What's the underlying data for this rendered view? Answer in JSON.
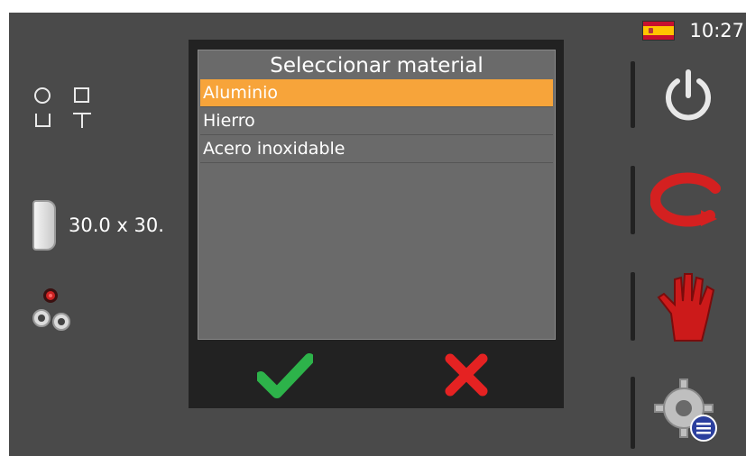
{
  "status_bar": {
    "language_flag": "spain-flag-icon",
    "time": "10:27"
  },
  "left_panel": {
    "shape_icons": "shape-selection-icon",
    "profile_dimensions": "30.0 x 30.",
    "nozzle_icon": "nozzle-icon"
  },
  "right_panel": {
    "buttons": [
      "power-icon",
      "cycle-icon",
      "manual-hand-icon",
      "settings-icon"
    ]
  },
  "dialog": {
    "title": "Seleccionar material",
    "items": [
      {
        "label": "Aluminio",
        "selected": true
      },
      {
        "label": "Hierro",
        "selected": false
      },
      {
        "label": "Acero inoxidable",
        "selected": false
      }
    ],
    "confirm_icon": "checkmark-icon",
    "cancel_icon": "cross-icon"
  },
  "colors": {
    "background": "#4a4a4a",
    "selected_item": "#f7a43a",
    "confirm": "#2db34a",
    "cancel": "#e52222",
    "cycle": "#d42020"
  }
}
